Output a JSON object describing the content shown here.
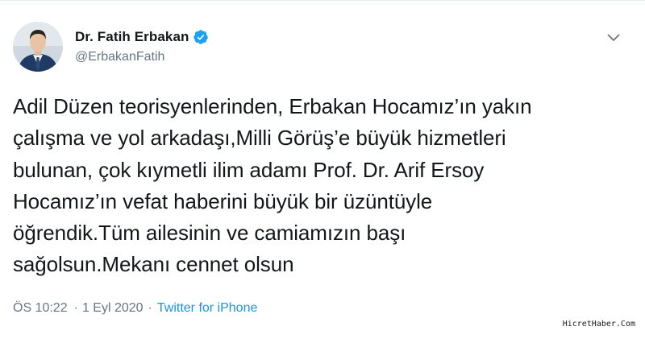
{
  "author": {
    "display_name": "Dr. Fatih Erbakan",
    "handle": "@ErbakanFatih",
    "verified": true
  },
  "tweet": {
    "text": "Adil Düzen teorisyenlerinden, Erbakan Hocamız’ın yakın\nçalışma ve yol arkadaşı,Milli Görüş’e büyük hizmetleri\nbulunan, çok kıymetli ilim adamı Prof. Dr. Arif Ersoy\nHocamız’ın vefat haberini büyük bir üzüntüyle\nöğrendik.Tüm ailesinin ve camiamızın başı\nsağolsun.Mekanı cennet olsun"
  },
  "meta": {
    "time": "ÖS 10:22",
    "separator": "·",
    "date": "1 Eyl 2020",
    "source": "Twitter for iPhone"
  },
  "watermark": "HicretHaber.Com",
  "colors": {
    "text_primary": "#14171a",
    "text_secondary": "#657786",
    "link": "#1b95e0",
    "verified_badge": "#1da1f2"
  },
  "icons": {
    "verified": "verified-badge-icon",
    "menu": "chevron-down-icon"
  }
}
